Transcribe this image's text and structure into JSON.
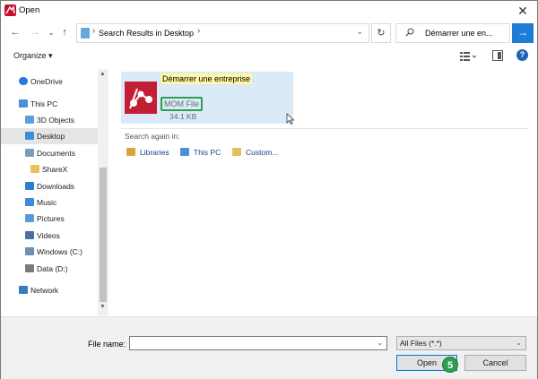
{
  "window": {
    "title": "Open"
  },
  "nav": {
    "back": "←",
    "forward": "→",
    "recent": "⌄",
    "up": "↑",
    "address_path": "Search Results in Desktop",
    "refresh": "↻",
    "search_value": "Démarrer une en...",
    "go": "→"
  },
  "toolbar": {
    "organize_label": "Organize ▾",
    "help": "?"
  },
  "sidebar": {
    "items": [
      {
        "label": "OneDrive",
        "color": "#2b79d8"
      },
      {
        "label": "This PC",
        "color": "#4a90d9"
      },
      {
        "label": "3D Objects",
        "color": "#5aa0e0"
      },
      {
        "label": "Desktop",
        "color": "#3a8fd6"
      },
      {
        "label": "Documents",
        "color": "#7d9cc0"
      },
      {
        "label": "ShareX",
        "color": "#e8c35a"
      },
      {
        "label": "Downloads",
        "color": "#2c7fd0"
      },
      {
        "label": "Music",
        "color": "#3c8bd9"
      },
      {
        "label": "Pictures",
        "color": "#5b9bd5"
      },
      {
        "label": "Videos",
        "color": "#4a6fa5"
      },
      {
        "label": "Windows (C:)",
        "color": "#6d8fb0"
      },
      {
        "label": "Data (D:)",
        "color": "#7b7b7b"
      },
      {
        "label": "Network",
        "color": "#3a7cc4"
      }
    ]
  },
  "content": {
    "result": {
      "name": "Démarrer une entreprise",
      "type": "MOM File",
      "size": "34.1 KB"
    },
    "search_again_label": "Search again in:",
    "search_again": [
      {
        "label": "Libraries",
        "color": "#d9a53a"
      },
      {
        "label": "This PC",
        "color": "#4a90d9"
      },
      {
        "label": "Custom...",
        "color": "#e0c25a"
      }
    ]
  },
  "footer": {
    "filename_label": "File name:",
    "filename_value": "",
    "filetype_value": "All Files (*.*)",
    "open_label": "Open",
    "cancel_label": "Cancel",
    "step_badge": "5"
  },
  "colors": {
    "accent": "#1c7cd6",
    "highlight_green": "#2e9e4f",
    "selection": "#dbeaf7",
    "brand_red": "#c8102e"
  }
}
